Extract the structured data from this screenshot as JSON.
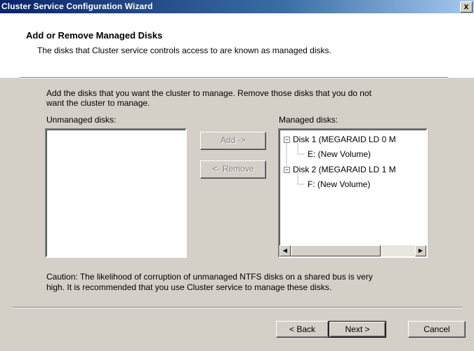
{
  "window": {
    "title": "Cluster Service Configuration Wizard",
    "close_glyph": "x"
  },
  "header": {
    "title": "Add or Remove Managed Disks",
    "subtitle": "The disks that Cluster service controls access to are known as managed disks."
  },
  "body": {
    "instruction_line1": "Add the disks that you want the cluster to manage. Remove those disks that you do not",
    "instruction_line2": "want the cluster to manage.",
    "unmanaged_label": "Unmanaged disks:",
    "managed_label": "Managed disks:",
    "add_button": "Add ->",
    "remove_button": "<- Remove",
    "caution_line1": "Caution: The likelihood of corruption of unmanaged NTFS disks on a shared bus is very",
    "caution_line2": "high. It is recommended that you use Cluster service to manage these disks."
  },
  "managed_tree": [
    {
      "label": "Disk 1 (MEGARAID LD  0 M",
      "expander": "−",
      "children": [
        "E: (New Volume)"
      ]
    },
    {
      "label": "Disk 2 (MEGARAID LD  1 M",
      "expander": "−",
      "children": [
        "F: (New Volume)"
      ]
    }
  ],
  "scrollbar": {
    "left_arrow": "◀",
    "right_arrow": "▶"
  },
  "footer": {
    "back_button": "< Back",
    "next_button": "Next >",
    "cancel_button": "Cancel"
  }
}
